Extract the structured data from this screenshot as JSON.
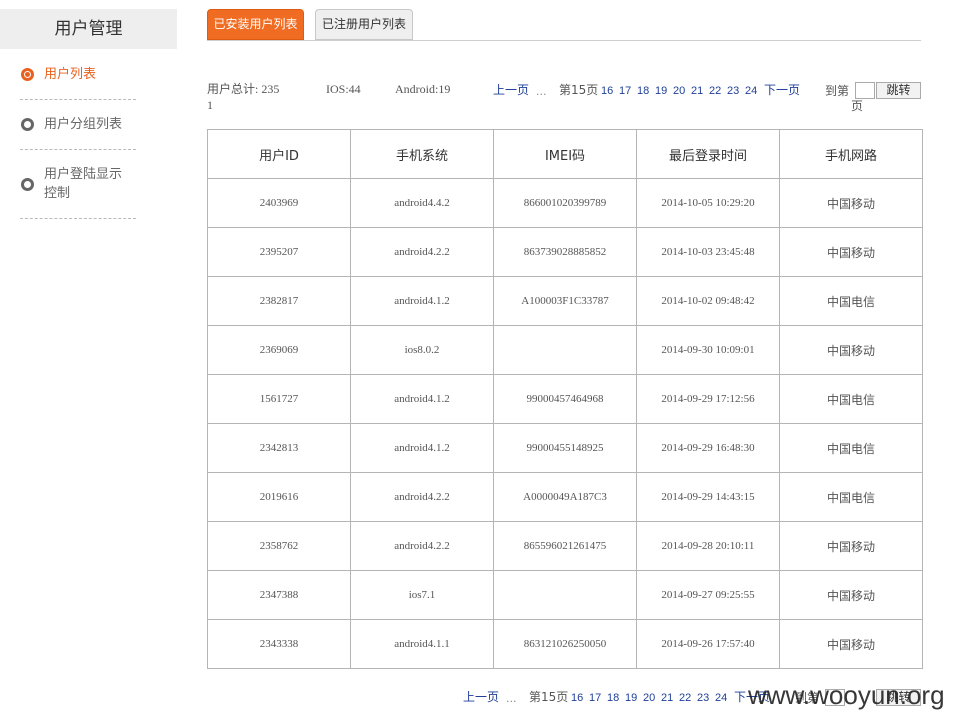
{
  "sidebar": {
    "title": "用户管理",
    "items": [
      {
        "label": "用户列表"
      },
      {
        "label": "用户分组列表"
      },
      {
        "label": "用户登陆显示",
        "label2": "控制"
      }
    ]
  },
  "tabs": {
    "installed": "已安装用户列表",
    "registered": "已注册用户列表"
  },
  "stats": {
    "total_label": "用户总计: 235",
    "total_wrap": "1",
    "ios": "IOS:44",
    "android": "Android:19"
  },
  "pager": {
    "prev": "上一页",
    "dots": "...",
    "current": "第15页",
    "pages": [
      "16",
      "17",
      "18",
      "19",
      "20",
      "21",
      "22",
      "23",
      "24"
    ],
    "next": "下一页",
    "goto_label": "到第",
    "goto_suffix": "页",
    "jump": "跳转"
  },
  "table": {
    "headers": [
      "用户ID",
      "手机系统",
      "IMEI码",
      "最后登录时间",
      "手机网路"
    ],
    "rows": [
      [
        "2403969",
        "android4.4.2",
        "866001020399789",
        "2014-10-05 10:29:20",
        "中国移动"
      ],
      [
        "2395207",
        "android4.2.2",
        "863739028885852",
        "2014-10-03 23:45:48",
        "中国移动"
      ],
      [
        "2382817",
        "android4.1.2",
        "A100003F1C33787",
        "2014-10-02 09:48:42",
        "中国电信"
      ],
      [
        "2369069",
        "ios8.0.2",
        "",
        "2014-09-30 10:09:01",
        "中国移动"
      ],
      [
        "1561727",
        "android4.1.2",
        "99000457464968",
        "2014-09-29 17:12:56",
        "中国电信"
      ],
      [
        "2342813",
        "android4.1.2",
        "99000455148925",
        "2014-09-29 16:48:30",
        "中国电信"
      ],
      [
        "2019616",
        "android4.2.2",
        "A0000049A187C3",
        "2014-09-29 14:43:15",
        "中国电信"
      ],
      [
        "2358762",
        "android4.2.2",
        "865596021261475",
        "2014-09-28 20:10:11",
        "中国移动"
      ],
      [
        "2347388",
        "ios7.1",
        "",
        "2014-09-27 09:25:55",
        "中国移动"
      ],
      [
        "2343338",
        "android4.1.1",
        "863121026250050",
        "2014-09-26 17:57:40",
        "中国移动"
      ]
    ]
  },
  "watermark": "www.wooyun.org"
}
